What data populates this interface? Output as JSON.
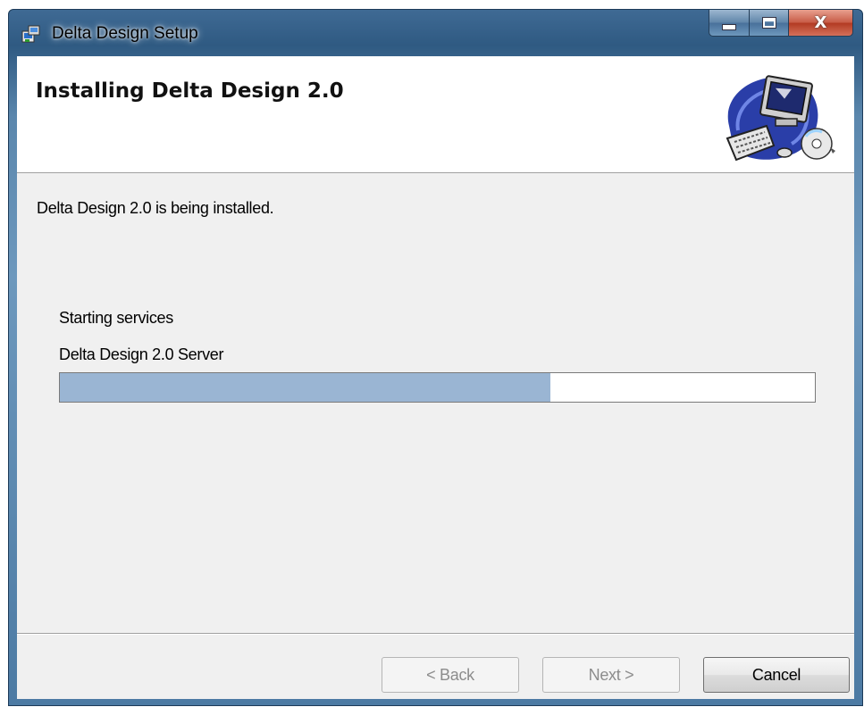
{
  "window": {
    "title": "Delta Design Setup",
    "icons": {
      "app": "installer-icon",
      "minimize": "minimize-icon",
      "maximize": "maximize-icon",
      "close": "close-icon"
    },
    "close_glyph": "X"
  },
  "banner": {
    "title": "Installing Delta Design 2.0",
    "art": "computer-with-cd-icon"
  },
  "body": {
    "status": "Delta Design 2.0 is being installed.",
    "current_action": "Starting services",
    "current_item": "Delta Design 2.0 Server",
    "progress_percent": 65,
    "progress_color": "#9ab5d3"
  },
  "buttons": {
    "back": "< Back",
    "next": "Next >",
    "cancel": "Cancel"
  }
}
